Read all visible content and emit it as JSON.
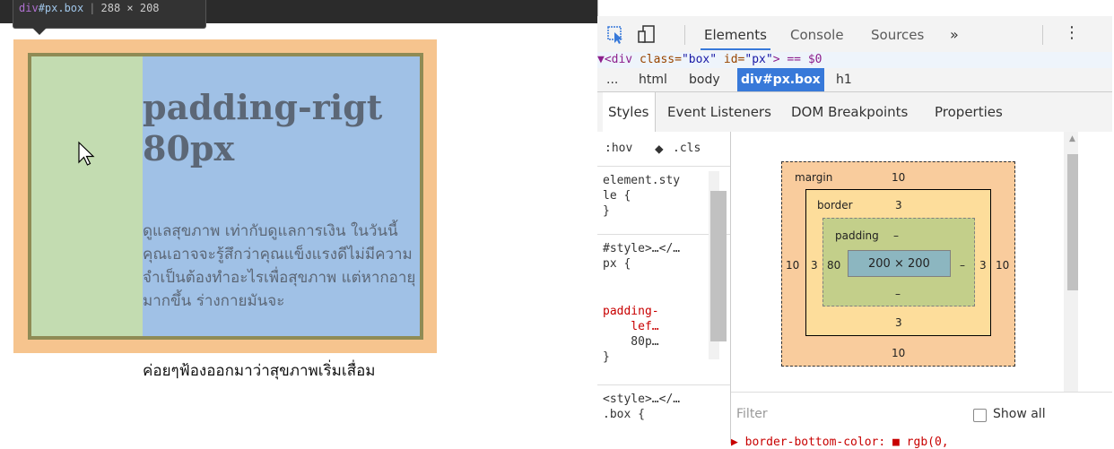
{
  "tooltip": {
    "tag": "div",
    "id_class": "#px.box",
    "dims": "288 × 208"
  },
  "preview": {
    "heading_line1": "padding-rigt",
    "heading_line2": "80px",
    "paragraph_in_box": "ดูแลสุขภาพ เท่ากับดูแลการเงิน ในวันนี้คุณเอาจจะรู้สึกว่าคุณแข็งแรงดีไม่มีความจำเป็นต้องทำอะไรเพื่อสุขภาพ แต่หากอายุมากขึ้น ร่างกายมันจะ",
    "paragraph_overflow": "ค่อยๆฟ้องออกมาว่าสุขภาพเริ่มเสื่อม",
    "colors": {
      "margin": "#f6c48e",
      "border": "#8f8b55",
      "padding": "#c3dcb1",
      "content": "#a0c1e6"
    }
  },
  "devtools": {
    "tabs": {
      "elements": "Elements",
      "console": "Console",
      "sources": "Sources",
      "more": "»"
    },
    "code_line": {
      "tag_open": "▼<div ",
      "attr1": "class=",
      "val1": "\"box\"",
      "attr2": " id=",
      "val2": "\"px\"",
      "tag_close": "> == $0"
    },
    "breadcrumbs": [
      "...",
      "html",
      "body",
      "div#px.box",
      "h1"
    ],
    "subtabs": {
      "styles": "Styles",
      "listeners": "Event Listeners",
      "dom_breakpoints": "DOM Breakpoints",
      "properties": "Properties"
    },
    "styles": {
      "hov": ":hov",
      "cls": ".cls",
      "rule1": "element.sty\nle {\n}",
      "rule2_selector": "#style>…</…\npx {",
      "rule2_prop": "padding-\n    lef…",
      "rule2_value": "    80p…\n}",
      "rule3": "<style>…</…\n.box {"
    },
    "box_model": {
      "margin_label": "margin",
      "margin_top": "10",
      "margin_bottom": "10",
      "margin_left": "10",
      "margin_right": "10",
      "border_label": "border",
      "border_top": "3",
      "border_bottom": "3",
      "border_left": "3",
      "border_right": "3",
      "padding_label": "padding",
      "padding_top": "–",
      "padding_bottom": "–",
      "padding_left": "80",
      "padding_right": "–",
      "content": "200 × 200"
    },
    "filter": {
      "placeholder": "Filter",
      "show_all": "Show all"
    },
    "prop_peek": "▶ border-bottom-color: ■ rgb(0,"
  }
}
